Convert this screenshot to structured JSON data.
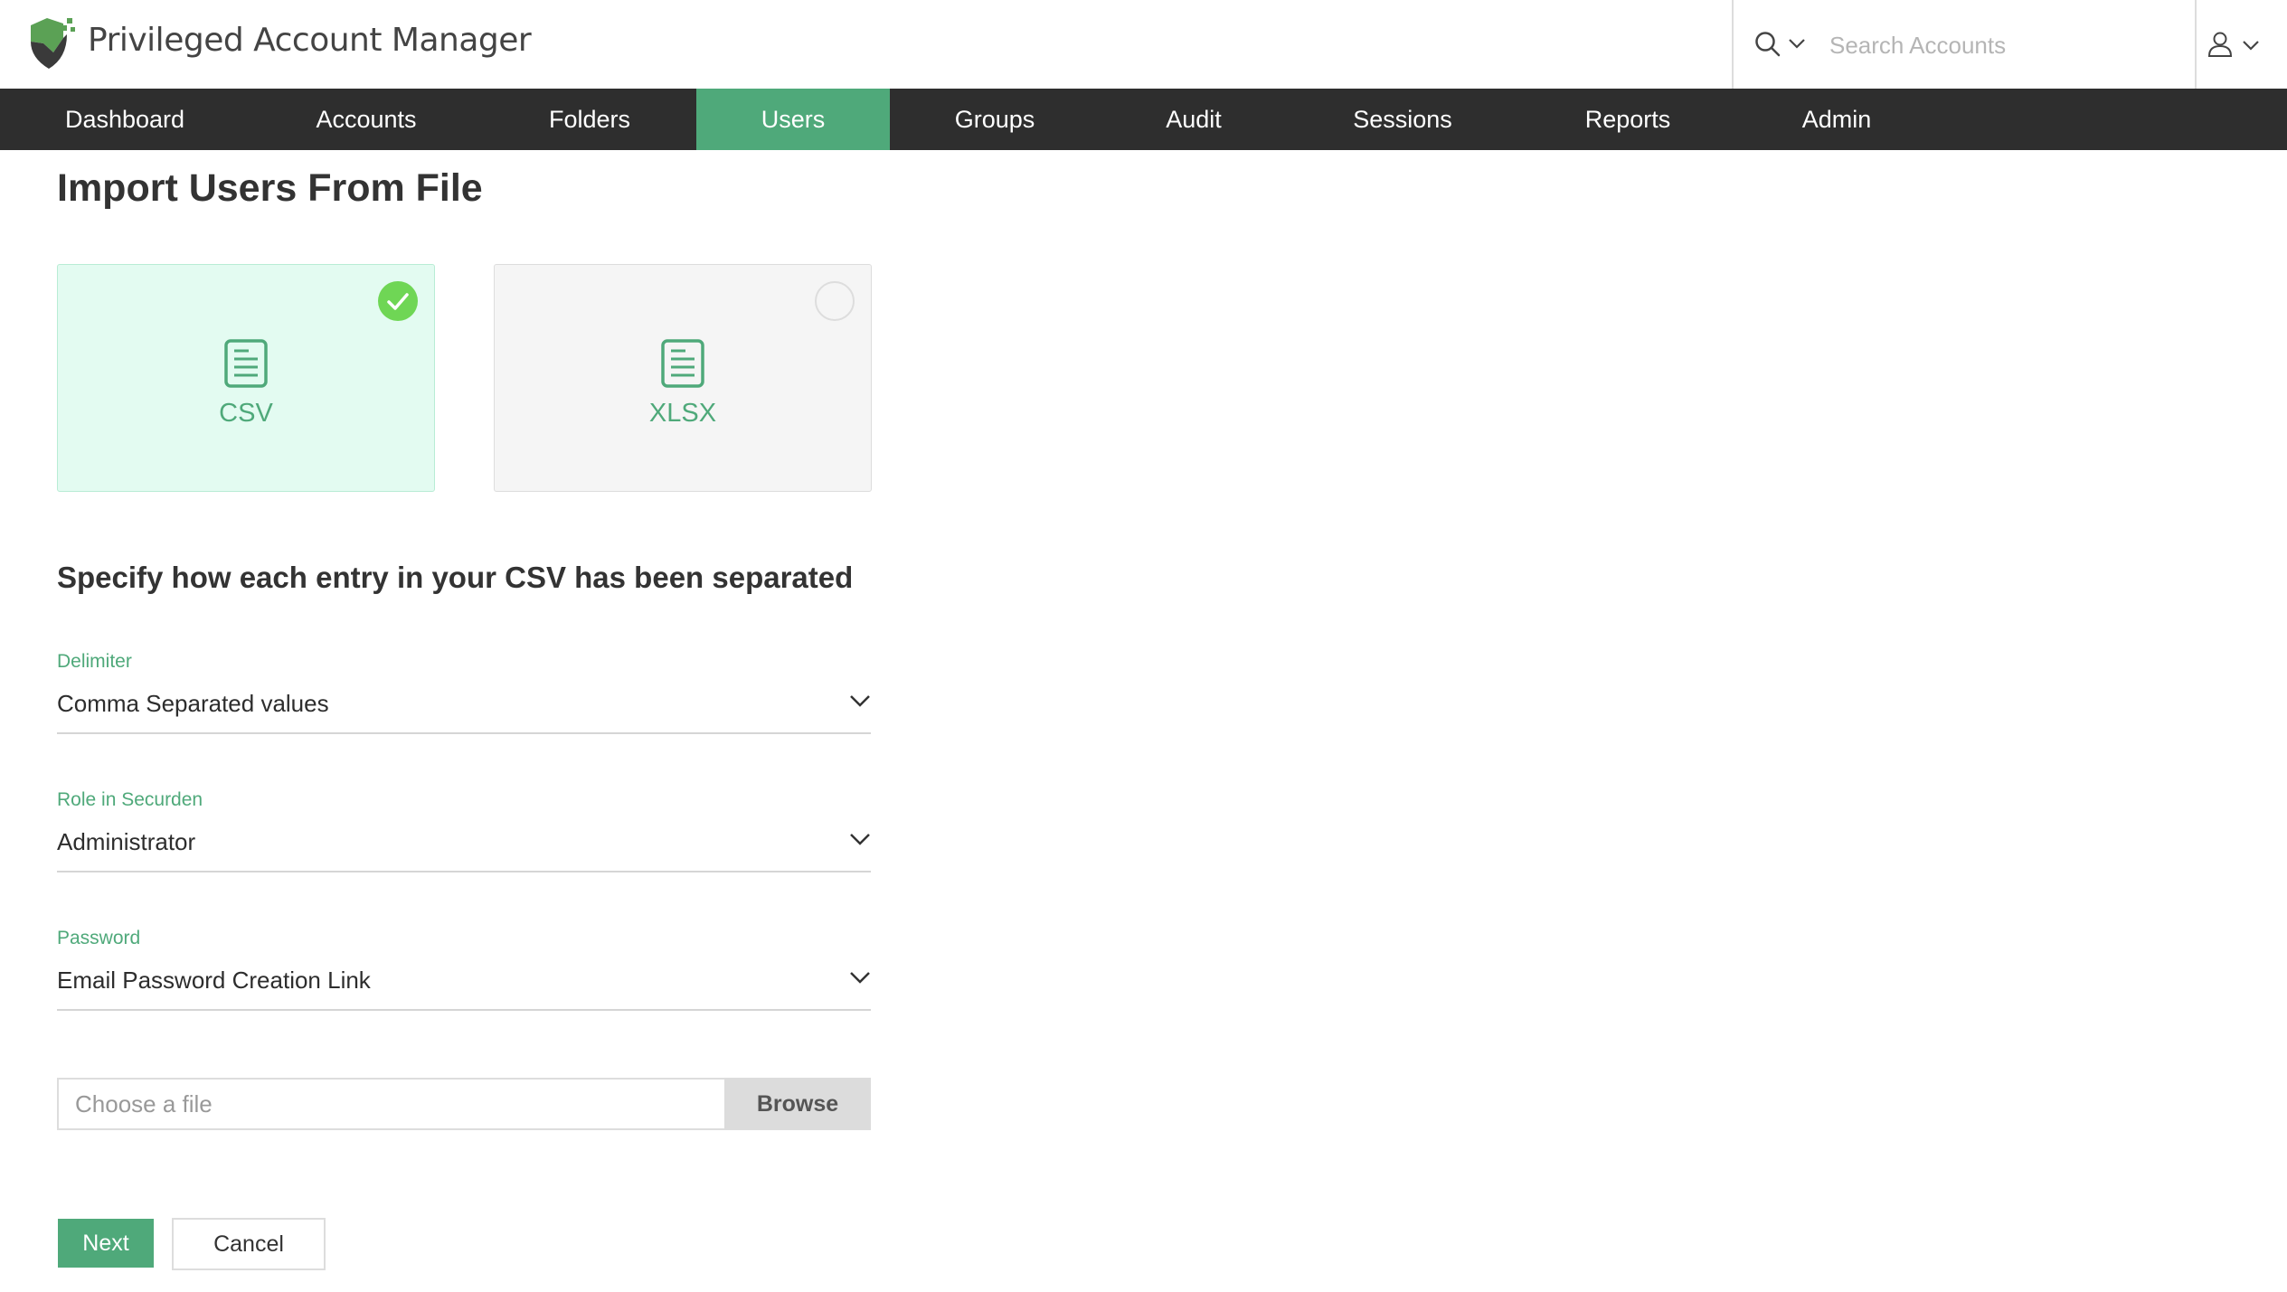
{
  "header": {
    "app_title": "Privileged Account Manager",
    "search": {
      "placeholder": "Search Accounts",
      "value": ""
    }
  },
  "nav": {
    "items": [
      {
        "label": "Dashboard",
        "active": false
      },
      {
        "label": "Accounts",
        "active": false
      },
      {
        "label": "Folders",
        "active": false
      },
      {
        "label": "Users",
        "active": true
      },
      {
        "label": "Groups",
        "active": false
      },
      {
        "label": "Audit",
        "active": false
      },
      {
        "label": "Sessions",
        "active": false
      },
      {
        "label": "Reports",
        "active": false
      },
      {
        "label": "Admin",
        "active": false
      }
    ]
  },
  "page": {
    "title": "Import Users From File",
    "file_types": [
      {
        "label": "CSV",
        "selected": true
      },
      {
        "label": "XLSX",
        "selected": false
      }
    ],
    "section_title": "Specify how each entry in your CSV has been separated",
    "fields": {
      "delimiter": {
        "label": "Delimiter",
        "value": "Comma Separated values"
      },
      "role": {
        "label": "Role in Securden",
        "value": "Administrator"
      },
      "password": {
        "label": "Password",
        "value": "Email Password Creation Link"
      }
    },
    "file": {
      "placeholder": "Choose a file",
      "browse_label": "Browse"
    },
    "actions": {
      "next_label": "Next",
      "cancel_label": "Cancel"
    }
  },
  "colors": {
    "accent": "#4fa97a",
    "nav_bg": "#2e2e2e",
    "check_green": "#6fd655",
    "selected_card_bg": "#e3fbf1"
  }
}
